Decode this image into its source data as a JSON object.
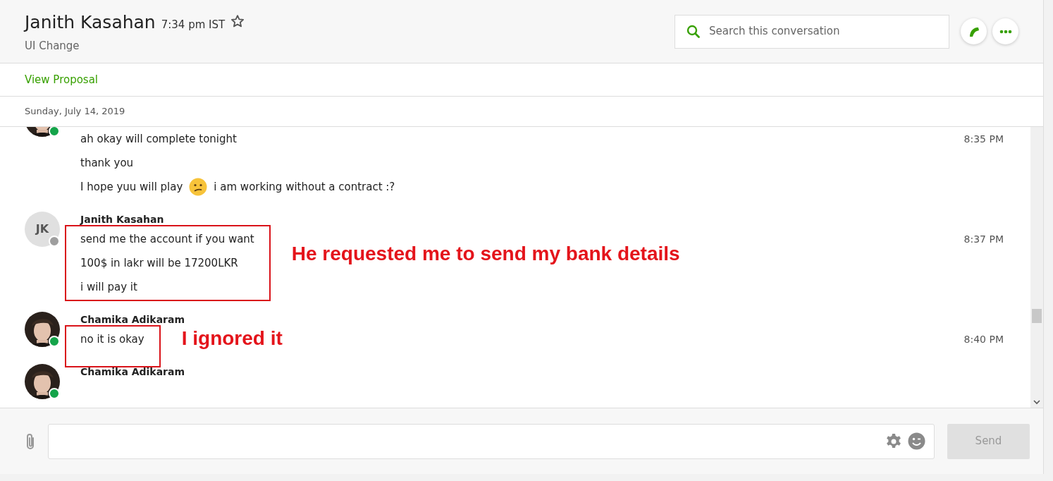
{
  "header": {
    "title": "Janith Kasahan",
    "local_time": "7:34 pm IST",
    "starred": false,
    "subtitle": "UI Change"
  },
  "search": {
    "placeholder": "Search this conversation"
  },
  "proposal_link": "View Proposal",
  "date": "Sunday, July 14, 2019",
  "messages": [
    {
      "online": true,
      "lines": [
        {
          "text": "ah okay will complete tonight",
          "time": "8:35 PM"
        },
        {
          "text": "thank you"
        },
        {
          "text": "I hope yuu will play",
          "emoji": true,
          "text_after": "i am working without a contract :?"
        }
      ]
    },
    {
      "name": "Janith Kasahan",
      "kind": "initials",
      "initials": "JK",
      "online": false,
      "lines": [
        {
          "text": "send me the account if you want",
          "time": "8:37 PM"
        },
        {
          "text": "100$ in lakr will be 17200LKR"
        },
        {
          "text": "i will pay it"
        }
      ],
      "annotation": "He requested me to send my bank details"
    },
    {
      "name": "Chamika Adikaram",
      "online": true,
      "lines": [
        {
          "text": "no it is okay",
          "time": "8:40 PM"
        }
      ],
      "annotation": "I ignored it"
    },
    {
      "name": "Chamika Adikaram",
      "online": true
    }
  ],
  "composer": {
    "send_label": "Send",
    "send_disabled": true
  }
}
